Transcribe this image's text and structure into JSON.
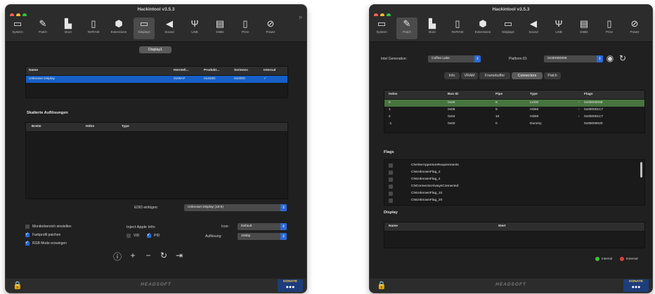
{
  "window_left": {
    "title": "Hackintool v3.5.3",
    "toolbar": [
      {
        "label": "System",
        "icon": "system-icon",
        "glyph": "▭"
      },
      {
        "label": "Patch",
        "icon": "patch-icon",
        "glyph": "✎"
      },
      {
        "label": "Boot",
        "icon": "boot-icon",
        "glyph": "▙"
      },
      {
        "label": "NVRAM",
        "icon": "nvram-icon",
        "glyph": "▯"
      },
      {
        "label": "Extensions",
        "icon": "extensions-icon",
        "glyph": "⬢"
      },
      {
        "label": "Displays",
        "icon": "displays-icon",
        "glyph": "▭"
      },
      {
        "label": "Sound",
        "icon": "sound-icon",
        "glyph": "◀"
      },
      {
        "label": "USB",
        "icon": "usb-icon",
        "glyph": "Ψ"
      },
      {
        "label": "Disks",
        "icon": "disks-icon",
        "glyph": "▤"
      },
      {
        "label": "PCIe",
        "icon": "pcie-icon",
        "glyph": "▯"
      },
      {
        "label": "Power",
        "icon": "power-icon",
        "glyph": "⊘"
      }
    ],
    "selected_tab": "Displays",
    "segment_label": "Display1",
    "display_table": {
      "headers": [
        "Name",
        "Herstell...",
        "Produkt...",
        "Seriennr.",
        "Internal"
      ],
      "rows": [
        [
          "Unknown Display",
          "0x06AF",
          "0x403D",
          "0x0000",
          "✓"
        ]
      ]
    },
    "resolutions_title": "Skalierte Auflösungen",
    "resolution_table": {
      "headers": [
        "Breite",
        "Höhe",
        "Type"
      ]
    },
    "edid_label": "EDID einfügen:",
    "edid_value": "Unknown Display (16:9)",
    "checkboxes": [
      {
        "label": "Monitorbereich einstellen",
        "checked": false
      },
      {
        "label": "Farbprofil patchen",
        "checked": true
      },
      {
        "label": "RGB Mode erzwingen",
        "checked": true
      }
    ],
    "inject_label": "Inject Apple Info:",
    "inject_vid": "VID",
    "inject_pid": "PID",
    "icon_label": "Icon:",
    "icon_value": "Default",
    "resolution_label": "Auflösung:",
    "resolution_value": "1080p",
    "brand": "HEADSOFT",
    "donate": "DONATE"
  },
  "window_right": {
    "title": "Hackintool v3.5.3",
    "selected_tab": "Patch",
    "intel_gen_label": "Intel Generation:",
    "intel_gen_value": "Coffee Lake",
    "platform_label": "Platform ID:",
    "platform_value": "0x3E9B0008",
    "tabs": [
      "Info",
      "VRAM",
      "Framebuffer",
      "Connectors",
      "Patch"
    ],
    "selected_subtab": "Connectors",
    "connectors": {
      "headers": [
        "Index",
        "Bus ID",
        "Pipe",
        "Type",
        "Flags"
      ],
      "rows": [
        [
          "0",
          "0x00",
          "8",
          "LVDS",
          "0x00000098"
        ],
        [
          "1",
          "0x05",
          "9",
          "HDMI",
          "0x000001C7"
        ],
        [
          "2",
          "0x04",
          "10",
          "HDMI",
          "0x000001C7"
        ],
        [
          "-1",
          "0x00",
          "0",
          "Dummy",
          "0x00000020"
        ]
      ]
    },
    "flags_title": "Flags",
    "flags": [
      "CNAlterAppertureRequirements",
      "CNUnknownFlag_2",
      "CNUnknownFlag_4",
      "CNConnectorAlwaysConnected",
      "CNUnknownFlag_10",
      "CNUnknownFlag_20"
    ],
    "display_title": "Display",
    "display_headers": [
      "Name",
      "Wert"
    ],
    "legend_internal": "Internal",
    "legend_external": "External",
    "legend_colors": {
      "internal": "#3fbf3f",
      "external": "#e0403a"
    },
    "brand": "HEADSOFT",
    "donate": "DONATE"
  }
}
